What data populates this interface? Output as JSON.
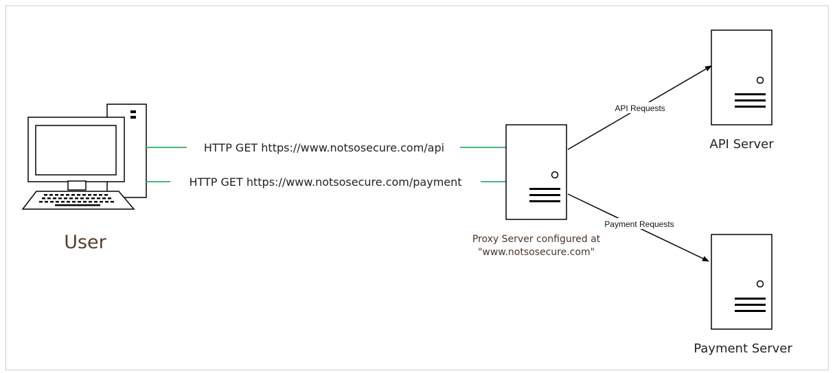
{
  "user_label": "User",
  "connections": {
    "api_request_label": "HTTP GET https://www.notsosecure.com/api",
    "payment_request_label": "HTTP GET https://www.notsosecure.com/payment",
    "line_color": "#44b87a"
  },
  "proxy": {
    "label_line1": "Proxy Server configured at",
    "label_line2": "\"www.notsosecure.com\""
  },
  "routes": {
    "api_label": "API Requests",
    "payment_label": "Payment Requests"
  },
  "servers": {
    "api_label": "API Server",
    "payment_label": "Payment Server"
  },
  "icons": {
    "user": "desktop-computer-icon",
    "proxy": "server-icon",
    "api": "server-icon",
    "payment": "server-icon"
  }
}
